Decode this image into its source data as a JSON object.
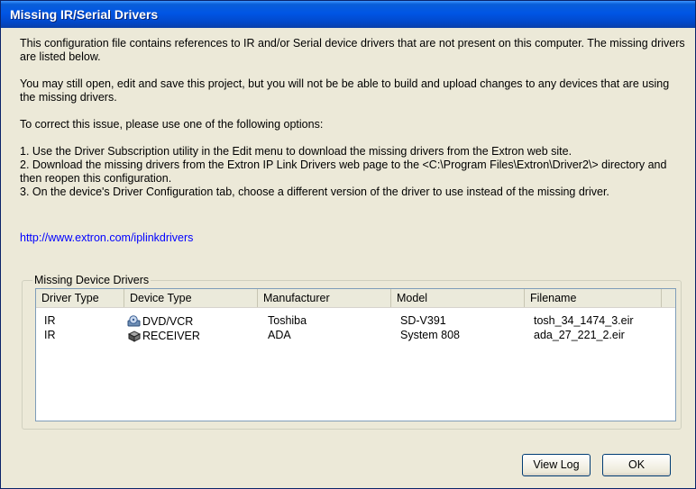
{
  "dialog": {
    "title": "Missing IR/Serial Drivers"
  },
  "message": {
    "p1": "This configuration file contains references to IR and/or Serial device drivers that are not present on this computer. The missing drivers are listed below.",
    "p2": "You may still open, edit and save this project, but you will not be be able to build and upload changes to any devices that are using the missing drivers.",
    "p3": "To correct this issue, please use one of the following options:",
    "opt1": "1. Use the Driver Subscription utility in the Edit menu to download the missing drivers from the Extron web site.",
    "opt2": "2. Download the missing drivers from the Extron IP Link Drivers web page to the <C:\\Program Files\\Extron\\Driver2\\> directory and then reopen this configuration.",
    "opt3": "3. On the device's Driver Configuration tab, choose a different version of the driver to use instead of the missing driver."
  },
  "link": {
    "text": "http://www.extron.com/iplinkdrivers"
  },
  "missing_drivers": {
    "group_label": "Missing Device Drivers",
    "columns": [
      "Driver Type",
      "Device Type",
      "Manufacturer",
      "Model",
      "Filename"
    ],
    "rows": [
      {
        "driver_type": "IR",
        "device_type": "DVD/VCR",
        "device_icon": "dvd-vcr-icon",
        "manufacturer": "Toshiba",
        "model": "SD-V391",
        "filename": "tosh_34_1474_3.eir"
      },
      {
        "driver_type": "IR",
        "device_type": "RECEIVER",
        "device_icon": "receiver-icon",
        "manufacturer": "ADA",
        "model": "System 808",
        "filename": "ada_27_221_2.eir"
      }
    ]
  },
  "buttons": {
    "view_log": "View Log",
    "ok": "OK"
  }
}
